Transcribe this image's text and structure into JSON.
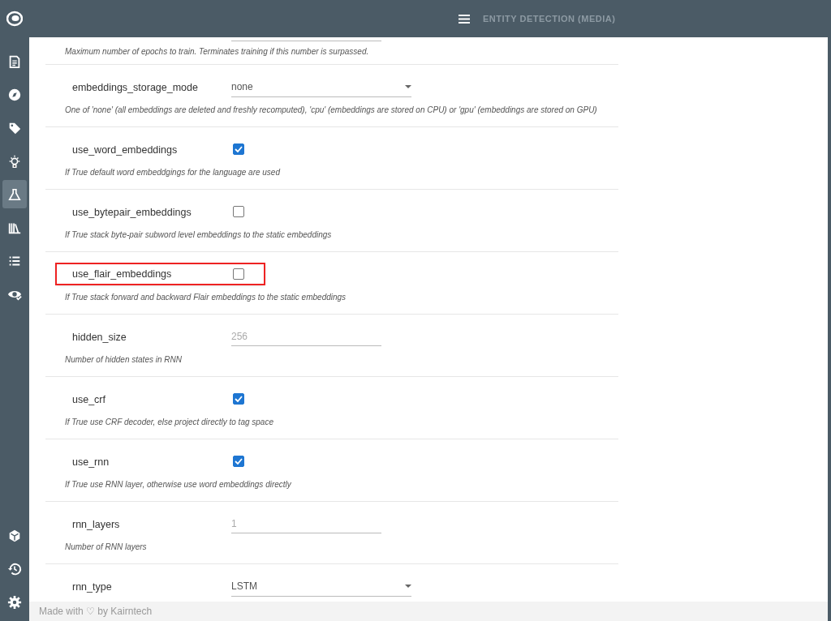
{
  "topbar": {
    "title": "ENTITY DETECTION (MEDIA)"
  },
  "sidebar": {
    "items": [
      {
        "selected": false
      },
      {
        "selected": false
      },
      {
        "selected": false
      },
      {
        "selected": false
      },
      {
        "selected": true
      },
      {
        "selected": false
      },
      {
        "selected": false
      },
      {
        "selected": false
      }
    ],
    "bottom_items": [
      {
        "selected": false
      },
      {
        "selected": false
      },
      {
        "selected": false
      }
    ]
  },
  "params": [
    {
      "kind": "partial",
      "description": "Maximum number of epochs to train. Terminates training if this number is surpassed."
    },
    {
      "kind": "select",
      "label": "embeddings_storage_mode",
      "value": "none",
      "description": "One of 'none' (all embeddings are deleted and freshly recomputed), 'cpu' (embeddings are stored on CPU) or 'gpu' (embeddings are stored on GPU)"
    },
    {
      "kind": "checkbox",
      "label": "use_word_embeddings",
      "checked": true,
      "highlighted": false,
      "description": "If True default word embeddgings for the language are used"
    },
    {
      "kind": "checkbox",
      "label": "use_bytepair_embeddings",
      "checked": false,
      "highlighted": false,
      "description": "If True stack byte-pair subword level embeddings to the static embeddings"
    },
    {
      "kind": "checkbox",
      "label": "use_flair_embeddings",
      "checked": false,
      "highlighted": true,
      "description": "If True stack forward and backward Flair embeddings to the static embeddings"
    },
    {
      "kind": "number",
      "label": "hidden_size",
      "placeholder": "256",
      "description": "Number of hidden states in RNN"
    },
    {
      "kind": "checkbox",
      "label": "use_crf",
      "checked": true,
      "highlighted": false,
      "description": "If True use CRF decoder, else project directly to tag space"
    },
    {
      "kind": "checkbox",
      "label": "use_rnn",
      "checked": true,
      "highlighted": false,
      "description": "If True use RNN layer, otherwise use word embeddings directly"
    },
    {
      "kind": "number",
      "label": "rnn_layers",
      "placeholder": "1",
      "description": "Number of RNN layers"
    },
    {
      "kind": "select",
      "label": "rnn_type",
      "value": "LSTM"
    }
  ],
  "footer": {
    "text": "Made with ♡ by Kairntech"
  }
}
